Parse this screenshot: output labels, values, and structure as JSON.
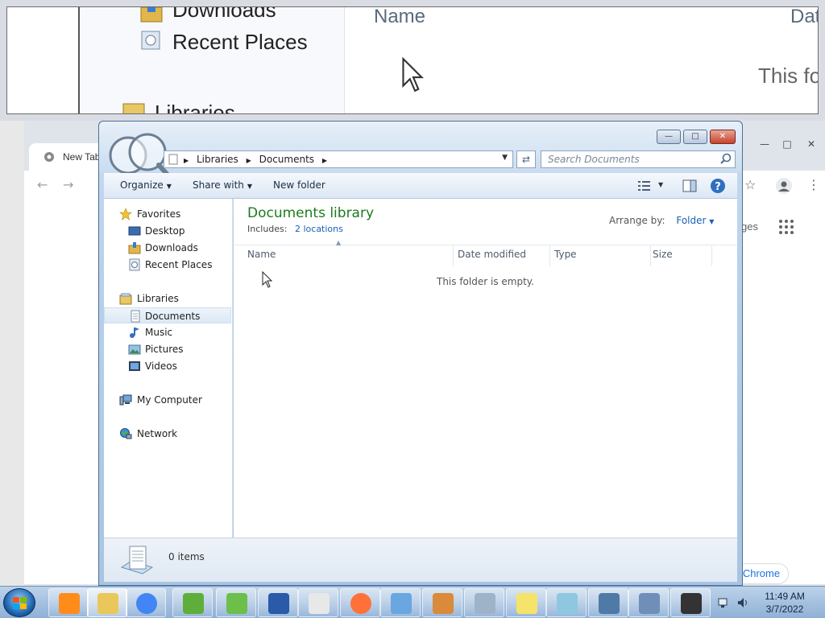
{
  "zoom_view": {
    "nav_items": [
      "Downloads",
      "Recent Places",
      "Libraries"
    ],
    "column_name": "Name",
    "column_date": "Dat",
    "empty_text": "This fo"
  },
  "background_chrome": {
    "tab_title": "New Tab",
    "page_text_partial": "ges",
    "customize_button_partial": "e Chrome"
  },
  "window": {
    "breadcrumb": [
      "Libraries",
      "Documents"
    ],
    "search_placeholder": "Search Documents",
    "commands": {
      "organize": "Organize",
      "share_with": "Share with",
      "new_folder": "New folder"
    }
  },
  "nav": {
    "favorites": {
      "label": "Favorites",
      "items": [
        {
          "label": "Desktop",
          "icon": "desktop-icon"
        },
        {
          "label": "Downloads",
          "icon": "downloads-icon"
        },
        {
          "label": "Recent Places",
          "icon": "recent-places-icon"
        }
      ]
    },
    "libraries": {
      "label": "Libraries",
      "items": [
        {
          "label": "Documents",
          "icon": "documents-icon",
          "selected": true
        },
        {
          "label": "Music",
          "icon": "music-icon"
        },
        {
          "label": "Pictures",
          "icon": "pictures-icon"
        },
        {
          "label": "Videos",
          "icon": "videos-icon"
        }
      ]
    },
    "computer": {
      "label": "My Computer",
      "icon": "computer-icon"
    },
    "network": {
      "label": "Network",
      "icon": "network-icon"
    }
  },
  "content": {
    "title": "Documents library",
    "includes_label": "Includes:",
    "includes_link": "2 locations",
    "arrange_label": "Arrange by:",
    "arrange_value": "Folder",
    "columns": [
      "Name",
      "Date modified",
      "Type",
      "Size"
    ],
    "empty_message": "This folder is empty."
  },
  "details": {
    "item_count": "0 items"
  },
  "taskbar": {
    "apps": [
      "media-player-icon",
      "file-explorer-icon",
      "chrome-icon",
      "chart-app-icon",
      "frog-app-icon",
      "powershell-icon",
      "solitaire-icon",
      "firefox-icon",
      "magnifier-icon",
      "paint-icon",
      "calculator-icon",
      "sticky-notes-icon",
      "notepad-icon",
      "network-lock-icon",
      "remote-desktop-icon",
      "chess-icon"
    ],
    "time": "11:49 AM",
    "date": "3/7/2022"
  },
  "colors": {
    "library_title": "#1e7a1e",
    "link": "#1a5fb4",
    "window_frame": "#b9d1ea",
    "taskbar": "#a6c2e2"
  }
}
